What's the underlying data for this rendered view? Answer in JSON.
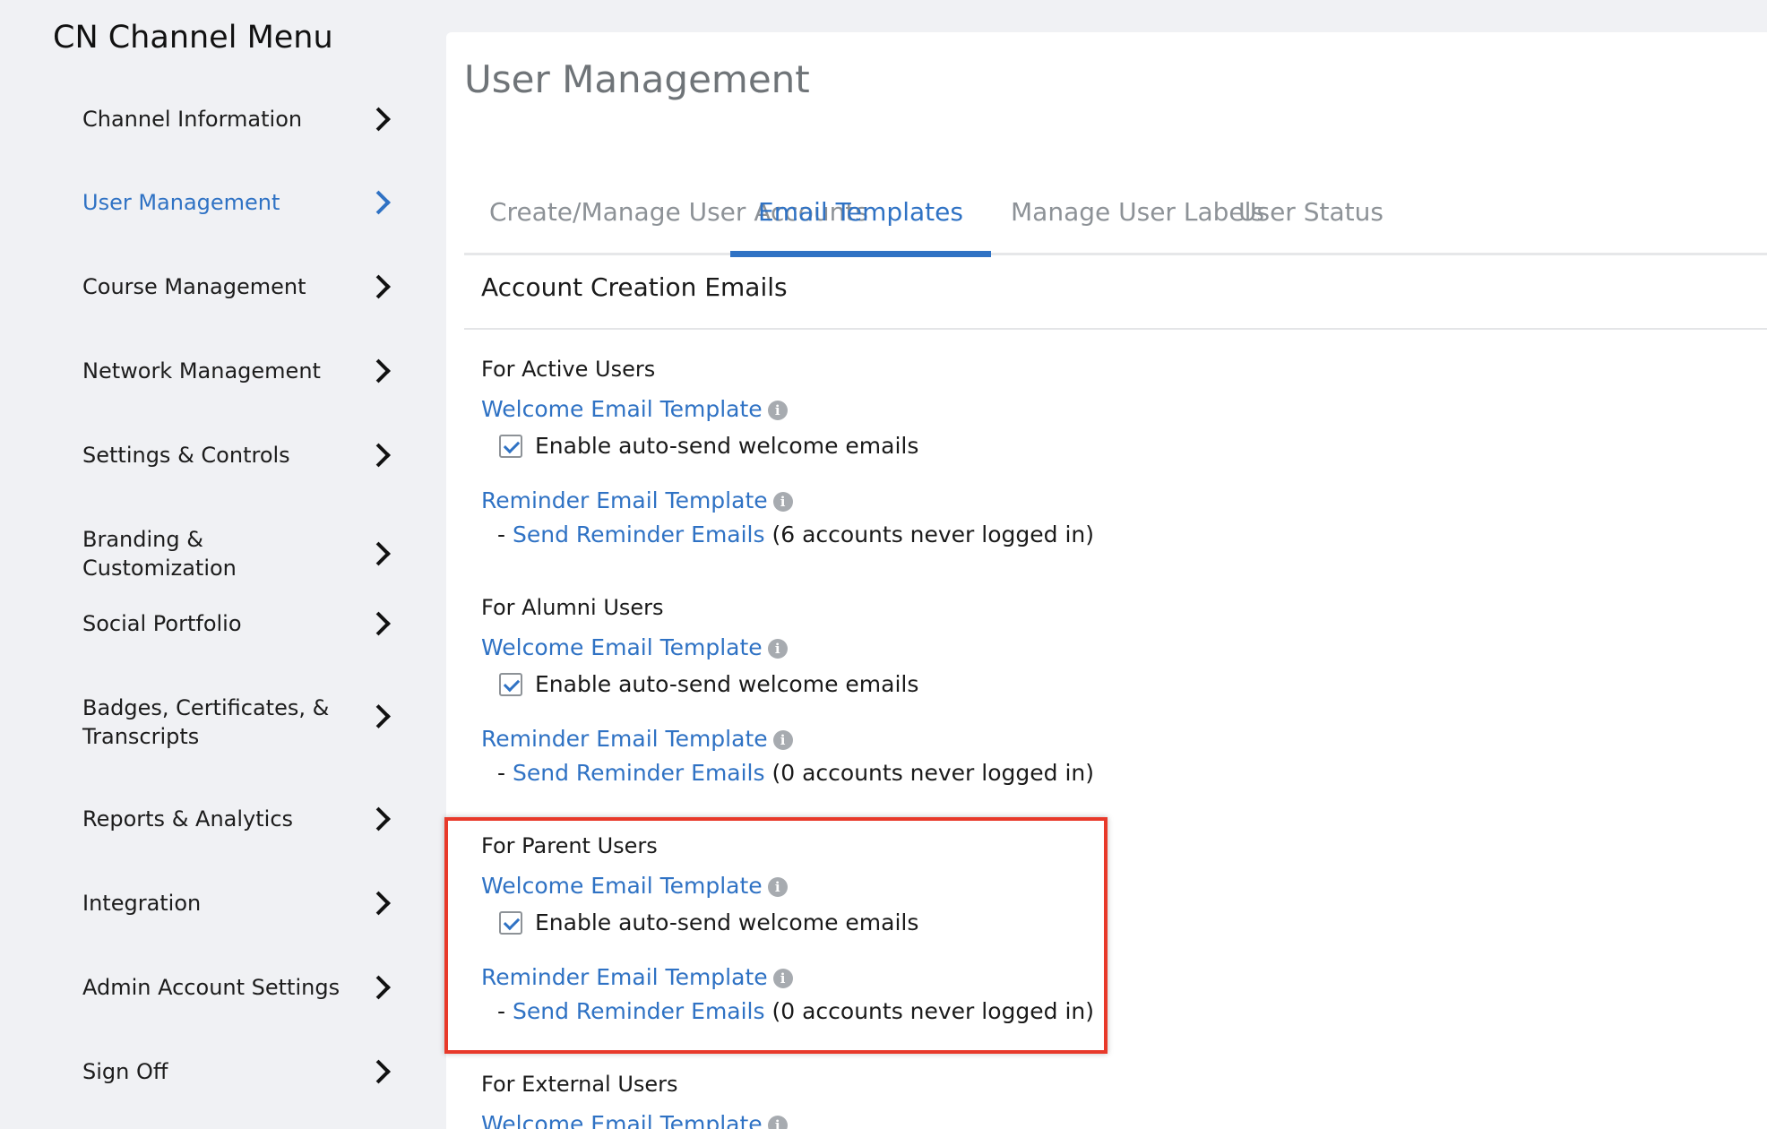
{
  "sidebar": {
    "title": "CN Channel Menu",
    "items": [
      {
        "label": "Channel Information"
      },
      {
        "label": "User Management",
        "active": true
      },
      {
        "label": "Course Management"
      },
      {
        "label": "Network Management"
      },
      {
        "label": "Settings & Controls"
      },
      {
        "label": "Branding & Customization"
      },
      {
        "label": "Social Portfolio"
      },
      {
        "label": "Badges, Certificates, & Transcripts"
      },
      {
        "label": "Reports & Analytics"
      },
      {
        "label": "Integration"
      },
      {
        "label": "Admin Account Settings"
      },
      {
        "label": "Sign Off"
      }
    ]
  },
  "main": {
    "title": "User Management",
    "tabs": [
      {
        "label": "Create/Manage User Accounts"
      },
      {
        "label": "Email Templates",
        "active": true
      },
      {
        "label": "Manage User Labels"
      },
      {
        "label": "User Status"
      }
    ],
    "section_heading": "Account Creation Emails",
    "groups": [
      {
        "title": "For Active Users",
        "welcome_link": "Welcome Email Template",
        "auto_send_label": "Enable auto-send welcome emails",
        "auto_send_checked": true,
        "reminder_link": "Reminder Email Template",
        "send_prefix": "-",
        "send_link": "Send Reminder Emails",
        "send_suffix": "(6 accounts never logged in)"
      },
      {
        "title": "For Alumni Users",
        "welcome_link": "Welcome Email Template",
        "auto_send_label": "Enable auto-send welcome emails",
        "auto_send_checked": true,
        "reminder_link": "Reminder Email Template",
        "send_prefix": "-",
        "send_link": "Send Reminder Emails",
        "send_suffix": "(0 accounts never logged in)"
      },
      {
        "title": "For Parent Users",
        "welcome_link": "Welcome Email Template",
        "auto_send_label": "Enable auto-send welcome emails",
        "auto_send_checked": true,
        "reminder_link": "Reminder Email Template",
        "send_prefix": "-",
        "send_link": "Send Reminder Emails",
        "send_suffix": "(0 accounts never logged in)"
      },
      {
        "title": "For External Users",
        "welcome_link": "Welcome Email Template"
      }
    ]
  },
  "icons": {
    "info": "info-icon",
    "chevron": "chevron-right-icon",
    "check": "checkmark-icon"
  },
  "colors": {
    "accent": "#2f72c4",
    "highlight": "#e8392a",
    "background": "#f0f1f4"
  }
}
